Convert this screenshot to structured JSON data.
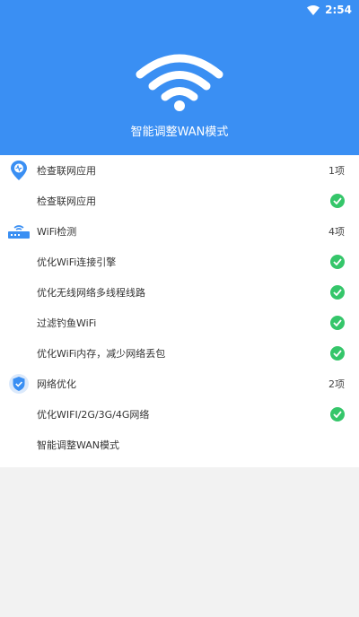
{
  "status_bar": {
    "time": "2:54"
  },
  "header": {
    "title": "智能调整WAN模式"
  },
  "sections": [
    {
      "title": "检查联网应用",
      "count": "1项",
      "items": [
        {
          "label": "检查联网应用",
          "done": true
        }
      ]
    },
    {
      "title": "WiFi检测",
      "count": "4项",
      "items": [
        {
          "label": "优化WiFi连接引擎",
          "done": true
        },
        {
          "label": "优化无线网络多线程线路",
          "done": true
        },
        {
          "label": "过滤钓鱼WiFi",
          "done": true
        },
        {
          "label": "优化WiFi内存，减少网络丢包",
          "done": true
        }
      ]
    },
    {
      "title": "网络优化",
      "count": "2项",
      "items": [
        {
          "label": "优化WIFI/2G/3G/4G网络",
          "done": true
        },
        {
          "label": "智能调整WAN模式",
          "done": false
        }
      ]
    }
  ],
  "colors": {
    "header": "#3a8ff3",
    "check": "#35c66a"
  }
}
